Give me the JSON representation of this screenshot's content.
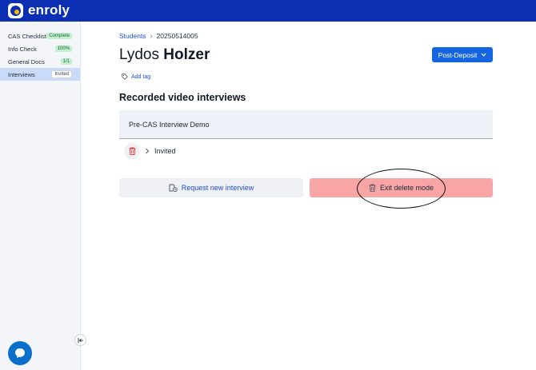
{
  "brand": {
    "name": "enroly",
    "icon": "enroly-logo-icon"
  },
  "sidebar": {
    "items": [
      {
        "label": "CAS Checklist",
        "badge": "Complete",
        "badge_color": "#c5f0d0"
      },
      {
        "label": "Info Check",
        "badge": "100%",
        "badge_color": "#c5f0d0"
      },
      {
        "label": "General Docs",
        "badge": "1/1",
        "badge_color": "#c5f0d0"
      },
      {
        "label": "Interviews",
        "badge": "Invited",
        "badge_color": "#ffffff",
        "active": true
      }
    ],
    "collapse_icon": "collapse-left-icon"
  },
  "breadcrumb": {
    "link": "Students",
    "current": "20250514005"
  },
  "student": {
    "first_name": "Lydos",
    "last_name": "Holzer"
  },
  "status_dropdown": {
    "label": "Post-Deposit",
    "icon": "chevron-down-icon"
  },
  "tags": {
    "add_label": "Add tag",
    "icon": "tag-icon"
  },
  "interviews": {
    "title": "Recorded video interviews",
    "card_title": "Pre-CAS Interview Demo",
    "entry_status": "Invited"
  },
  "actions": {
    "request_label": "Request new interview",
    "exit_delete_label": "Exit delete mode"
  },
  "colors": {
    "topbar": "#0a2fb3",
    "primary": "#1565e0",
    "danger_bg": "#f9a5a5",
    "active_sidebar": "#c9dbf8"
  },
  "chat": {
    "icon": "chat-bubble-icon"
  }
}
